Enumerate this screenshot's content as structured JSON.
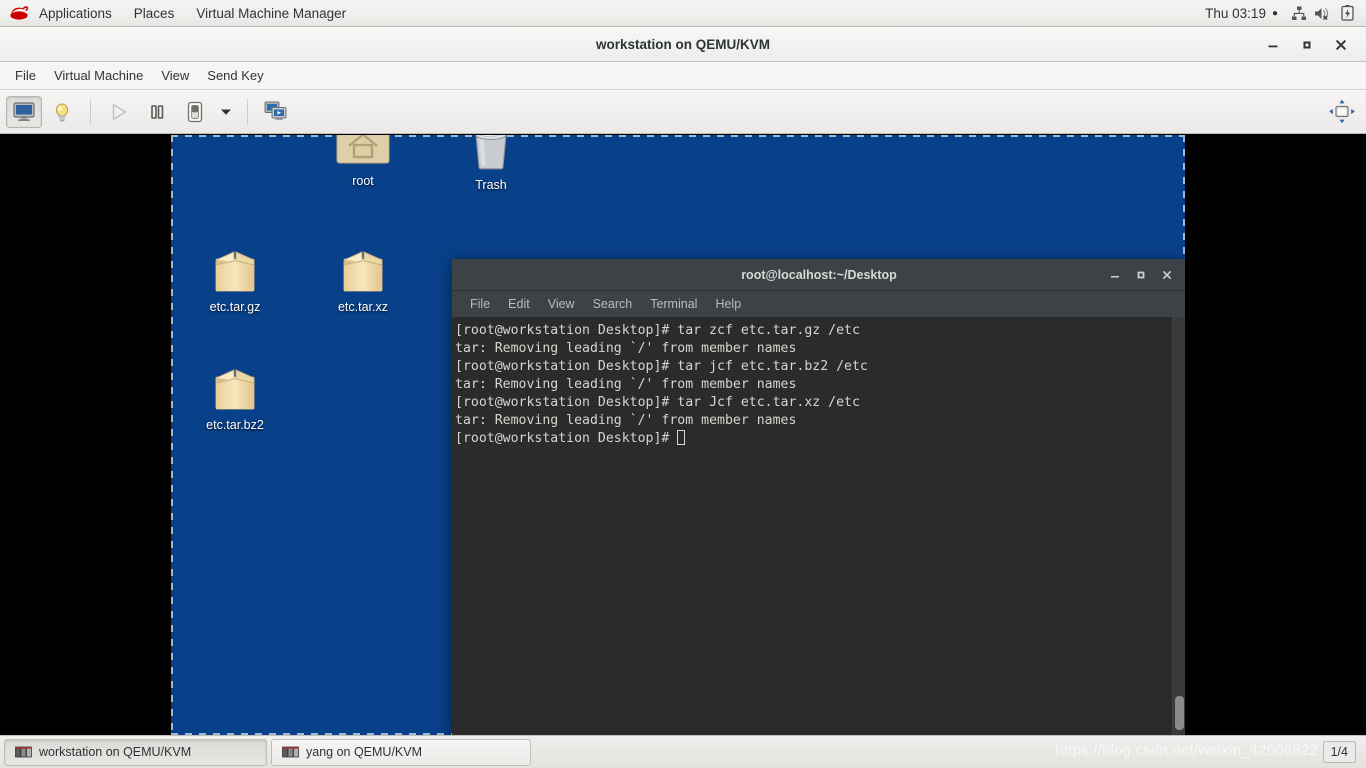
{
  "gnome_topbar": {
    "logo_icon": "redhat-logo-icon",
    "menus": [
      {
        "label": "Applications"
      },
      {
        "label": "Places"
      },
      {
        "label": "Virtual Machine Manager"
      }
    ],
    "clock": "Thu 03:19",
    "clock_dot": "●",
    "status_icons": [
      {
        "name": "network-wired-icon"
      },
      {
        "name": "volume-muted-icon"
      },
      {
        "name": "battery-charging-icon"
      }
    ]
  },
  "vmm_window": {
    "title": "workstation on QEMU/KVM",
    "window_controls": [
      {
        "name": "minimize-button",
        "glyph": "–"
      },
      {
        "name": "maximize-button",
        "glyph": "□"
      },
      {
        "name": "close-button",
        "glyph": "✕"
      }
    ],
    "menubar": [
      {
        "label": "File"
      },
      {
        "label": "Virtual Machine"
      },
      {
        "label": "View"
      },
      {
        "label": "Send Key"
      }
    ],
    "toolbar": [
      {
        "name": "show-console-button",
        "icon": "monitor-icon",
        "state": "active"
      },
      {
        "name": "show-details-button",
        "icon": "lightbulb-icon",
        "state": "normal"
      },
      {
        "name": "run-button",
        "icon": "play-icon",
        "state": "disabled"
      },
      {
        "name": "pause-button",
        "icon": "pause-icon",
        "state": "normal"
      },
      {
        "name": "shutdown-button",
        "icon": "power-switch-icon",
        "state": "normal"
      },
      {
        "name": "shutdown-dropdown",
        "icon": "chevron-down-icon",
        "state": "normal"
      },
      {
        "name": "snapshots-button",
        "icon": "screens-icon",
        "state": "normal"
      },
      {
        "name": "fullscreen-button",
        "icon": "fullscreen-resize-icon",
        "state": "normal"
      }
    ]
  },
  "vm_desktop": {
    "background_color": "#084089",
    "icons": [
      {
        "name": "desktop-icon-root",
        "label": "root",
        "icon": "home-folder-icon"
      },
      {
        "name": "desktop-icon-trash",
        "label": "Trash",
        "icon": "trash-can-icon"
      },
      {
        "name": "desktop-icon-etc-tar-gz",
        "label": "etc.tar.gz",
        "icon": "archive-box-icon"
      },
      {
        "name": "desktop-icon-etc-tar-xz",
        "label": "etc.tar.xz",
        "icon": "archive-box-icon"
      },
      {
        "name": "desktop-icon-etc-tar-bz2",
        "label": "etc.tar.bz2",
        "icon": "archive-box-icon"
      }
    ]
  },
  "terminal": {
    "title": "root@localhost:~/Desktop",
    "window_controls": [
      {
        "name": "terminal-minimize-button",
        "glyph": "–"
      },
      {
        "name": "terminal-maximize-button",
        "glyph": "□"
      },
      {
        "name": "terminal-close-button",
        "glyph": "✕"
      }
    ],
    "menubar": [
      {
        "label": "File"
      },
      {
        "label": "Edit"
      },
      {
        "label": "View"
      },
      {
        "label": "Search"
      },
      {
        "label": "Terminal"
      },
      {
        "label": "Help"
      }
    ],
    "output": "[root@workstation Desktop]# tar zcf etc.tar.gz /etc\ntar: Removing leading `/' from member names\n[root@workstation Desktop]# tar jcf etc.tar.bz2 /etc\ntar: Removing leading `/' from member names\n[root@workstation Desktop]# tar Jcf etc.tar.xz /etc\ntar: Removing leading `/' from member names\n",
    "prompt": "[root@workstation Desktop]# ",
    "background_color": "#2b2b2b",
    "foreground_color": "#d3d7cf"
  },
  "taskbar": {
    "items": [
      {
        "name": "taskbar-item-workstation",
        "label": "workstation on QEMU/KVM",
        "icon": "vm-window-icon",
        "active": true
      },
      {
        "name": "taskbar-item-yang",
        "label": "yang on QEMU/KVM",
        "icon": "vm-window-icon",
        "active": false
      }
    ],
    "workspace_indicator": "1/4"
  },
  "watermark": "https://blog.csdn.net/weixin_42006822"
}
